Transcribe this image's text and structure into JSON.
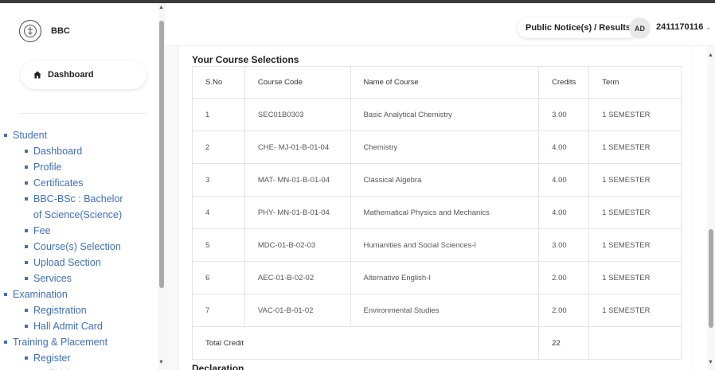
{
  "brand": {
    "name": "BBC",
    "logo_icon": "emblem-icon"
  },
  "sidebar": {
    "dashboard_label": "Dashboard",
    "tree": [
      {
        "level": 1,
        "label": "Student"
      },
      {
        "level": 2,
        "label": "Dashboard"
      },
      {
        "level": 2,
        "label": "Profile"
      },
      {
        "level": 2,
        "label": "Certificates"
      },
      {
        "level": 2,
        "label": "BBC-BSc : Bachelor"
      },
      {
        "level": 0,
        "label": "of Science(Science)"
      },
      {
        "level": 2,
        "label": "Fee"
      },
      {
        "level": 2,
        "label": "Course(s) Selection"
      },
      {
        "level": 2,
        "label": "Upload Section"
      },
      {
        "level": 2,
        "label": "Services"
      },
      {
        "level": 1,
        "label": "Examination"
      },
      {
        "level": 2,
        "label": "Registration"
      },
      {
        "level": 2,
        "label": "Hall Admit Card"
      },
      {
        "level": 1,
        "label": "Training & Placement"
      },
      {
        "level": 2,
        "label": "Register"
      },
      {
        "level": 2,
        "label": "Available Sessons"
      }
    ]
  },
  "header": {
    "notice_label": "Public Notice(s) / Results",
    "avatar_initials": "AD",
    "user_id": "2411170116"
  },
  "main": {
    "section_title": "Your Course Selections",
    "columns": [
      "S.No",
      "Course Code",
      "Name of Course",
      "Credits",
      "Term"
    ],
    "rows": [
      [
        "1",
        "SEC01B0303",
        "Basic Analytical Chemistry",
        "3.00",
        "1 SEMESTER"
      ],
      [
        "2",
        "CHE- MJ-01-B-01-04",
        "Chemistry",
        "4.00",
        "1 SEMESTER"
      ],
      [
        "3",
        "MAT- MN-01-B-01-04",
        "Classical Algebra",
        "4.00",
        "1 SEMESTER"
      ],
      [
        "4",
        "PHY- MN-01-B-01-04",
        "Mathematical Physics and Mechanics",
        "4.00",
        "1 SEMESTER"
      ],
      [
        "5",
        "MDC-01-B-02-03",
        "Humanities and Social Sciences-I",
        "3.00",
        "1 SEMESTER"
      ],
      [
        "6",
        "AEC-01-B-02-02",
        "Alternative English-I",
        "2.00",
        "1 SEMESTER"
      ],
      [
        "7",
        "VAC-01-B-01-02",
        "Environmental Studies",
        "2.00",
        "1 SEMESTER"
      ]
    ],
    "total_label": "Total Credit",
    "total_value": "22",
    "declaration_title": "Declaration"
  },
  "colors": {
    "link": "#3f6fb8",
    "scroll_thumb": "#a9a9a9"
  }
}
